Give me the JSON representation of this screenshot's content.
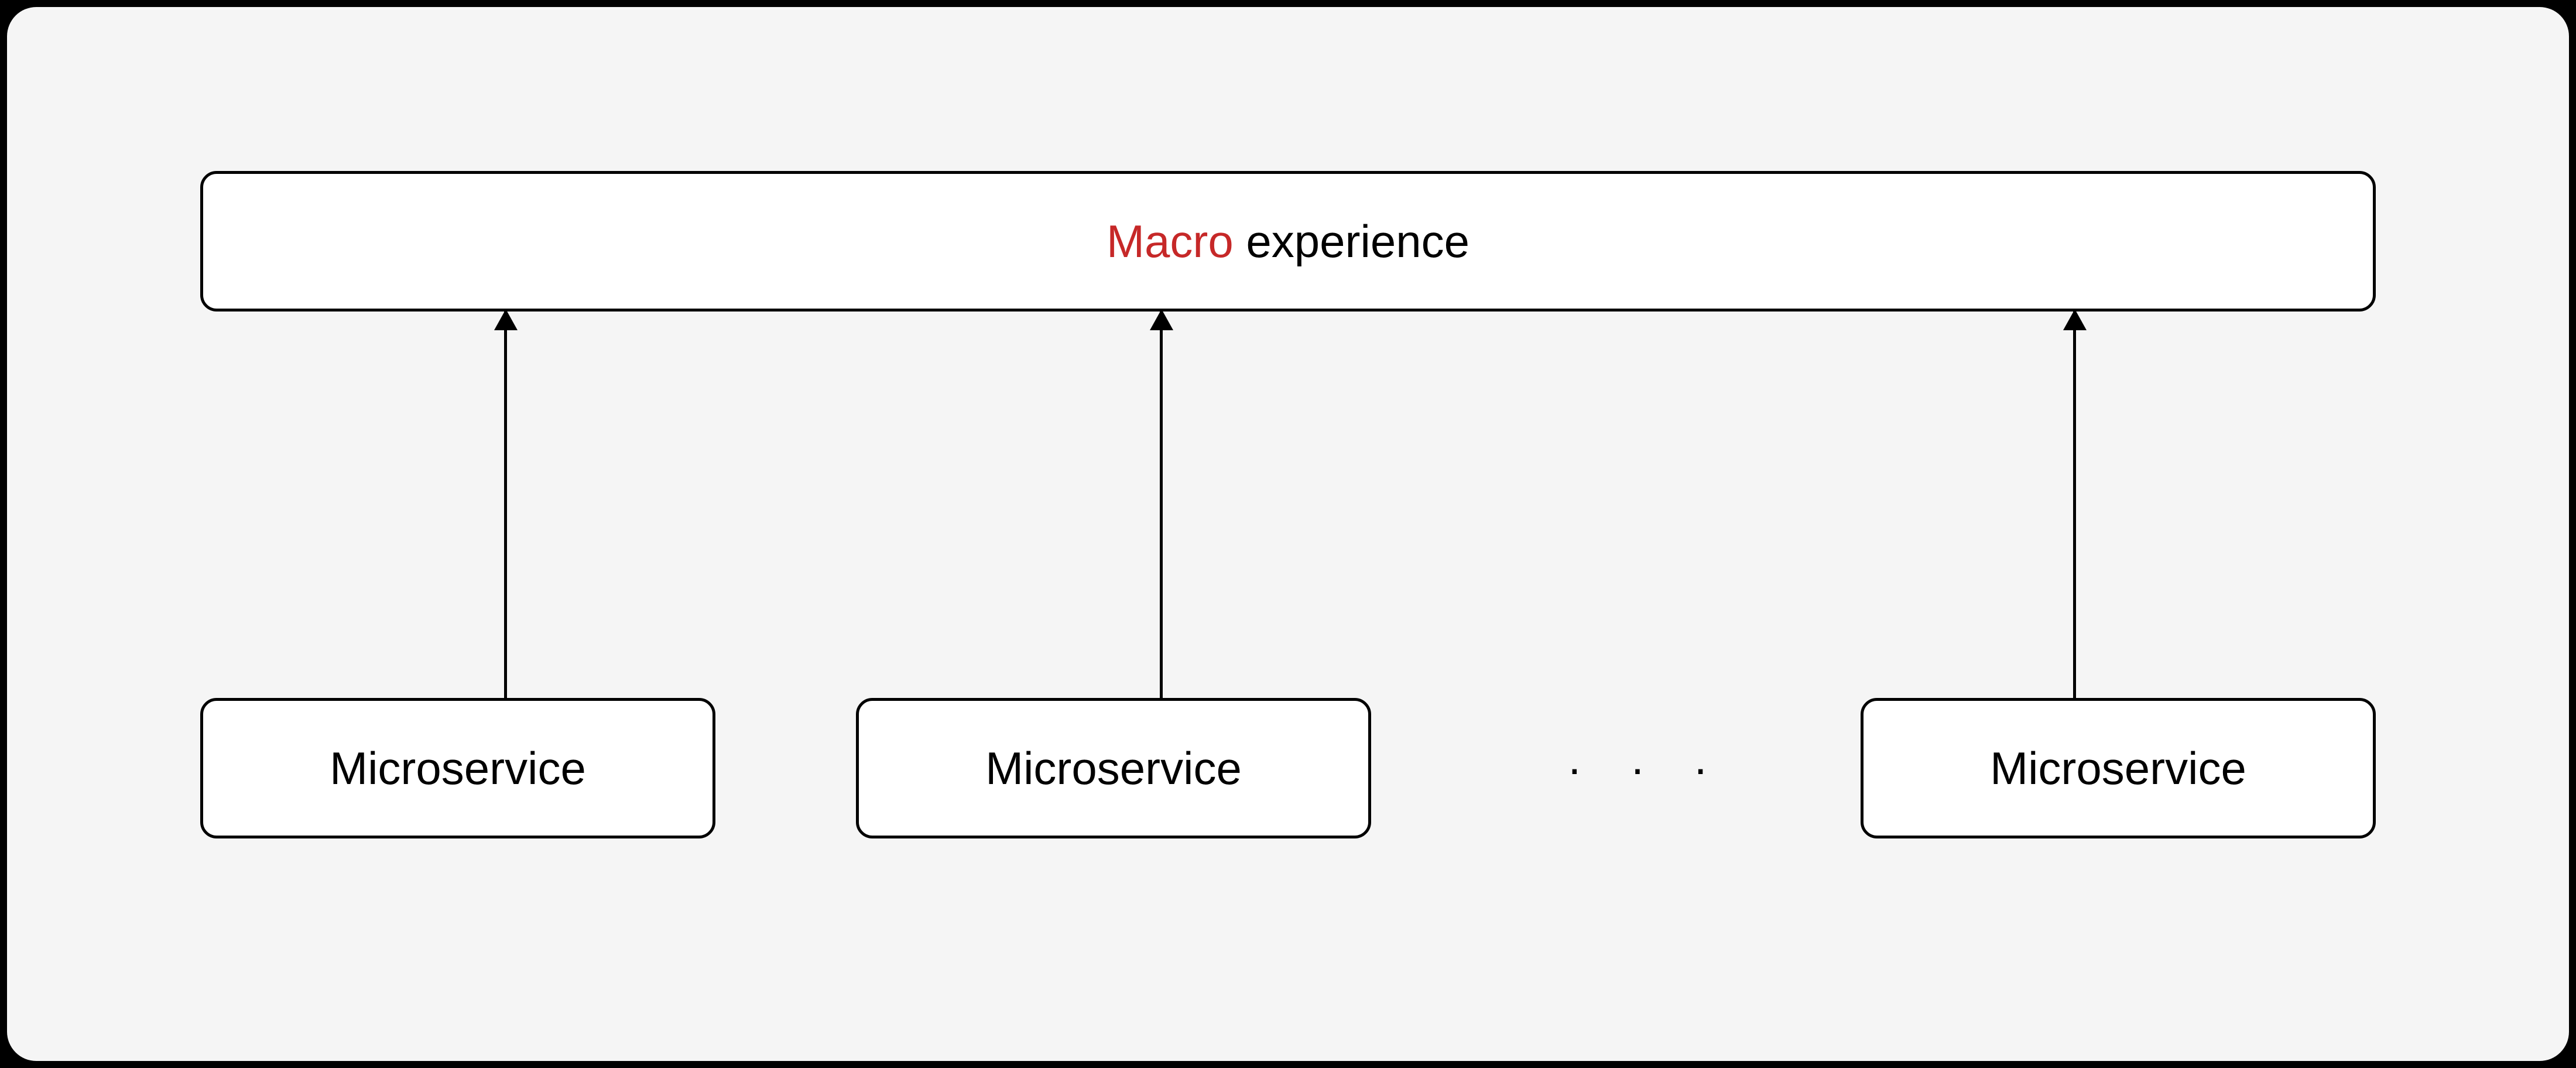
{
  "diagram": {
    "top_box": {
      "accent": "Macro",
      "rest": " experience"
    },
    "microservices": [
      {
        "label": "Microservice"
      },
      {
        "label": "Microservice"
      },
      {
        "label": "Microservice"
      }
    ],
    "ellipsis": "· · ·",
    "colors": {
      "accent": "#c62828",
      "border": "#000000",
      "frame_bg": "#f5f5f5",
      "box_bg": "#ffffff"
    }
  }
}
